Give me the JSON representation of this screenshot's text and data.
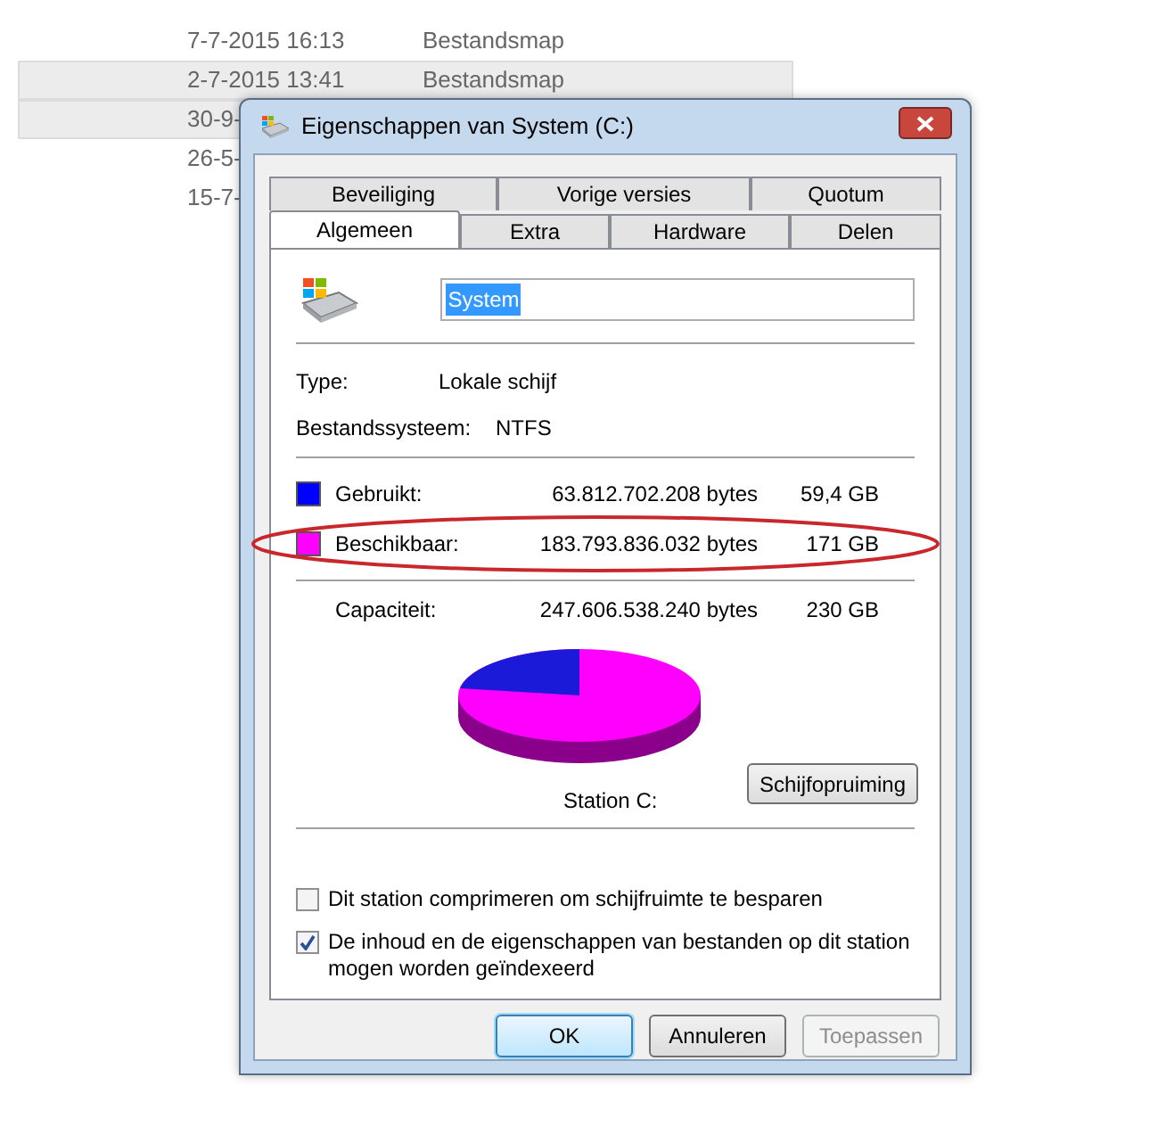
{
  "file_list": {
    "rows": [
      {
        "date": "7-7-2015 16:13",
        "type": "Bestandsmap",
        "selected": false
      },
      {
        "date": "2-7-2015 13:41",
        "type": "Bestandsmap",
        "selected": true
      },
      {
        "date": "30-9-",
        "selected": true
      },
      {
        "date": "26-5-",
        "selected": false
      },
      {
        "date": "15-7-",
        "selected": false
      }
    ]
  },
  "dialog": {
    "title": "Eigenschappen van System (C:)",
    "tab_rows": [
      [
        {
          "label": "Beveiliging",
          "selected": false
        },
        {
          "label": "Vorige versies",
          "selected": false
        },
        {
          "label": "Quotum",
          "selected": false
        }
      ],
      [
        {
          "label": "Algemeen",
          "selected": true
        },
        {
          "label": "Extra",
          "selected": false
        },
        {
          "label": "Hardware",
          "selected": false
        },
        {
          "label": "Delen",
          "selected": false
        }
      ]
    ],
    "name_field": {
      "value": "System"
    },
    "info": [
      {
        "label": "Type:",
        "value": "Lokale schijf"
      },
      {
        "label": "Bestandssysteem:",
        "value": "NTFS"
      }
    ],
    "storage": [
      {
        "label": "Gebruikt:",
        "bytes": "63.812.702.208 bytes",
        "size": "59,4 GB",
        "color": "#0000ff"
      },
      {
        "label": "Beschikbaar:",
        "bytes": "183.793.836.032 bytes",
        "size": "171 GB",
        "color": "#ff00ff"
      }
    ],
    "capacity": {
      "label": "Capaciteit:",
      "bytes": "247.606.538.240 bytes",
      "size": "230 GB"
    },
    "drive_label": "Station C:",
    "cleanup_button": "Schijfopruiming",
    "options": [
      {
        "label": "Dit station comprimeren om schijfruimte te besparen",
        "checked": false
      },
      {
        "label": "De inhoud en de eigenschappen van bestanden op dit station mogen worden geïndexeerd",
        "checked": true
      }
    ],
    "buttons": [
      {
        "label": "OK",
        "default": true,
        "disabled": false
      },
      {
        "label": "Annuleren",
        "default": false,
        "disabled": false
      },
      {
        "label": "Toepassen",
        "default": false,
        "disabled": true
      }
    ]
  }
}
